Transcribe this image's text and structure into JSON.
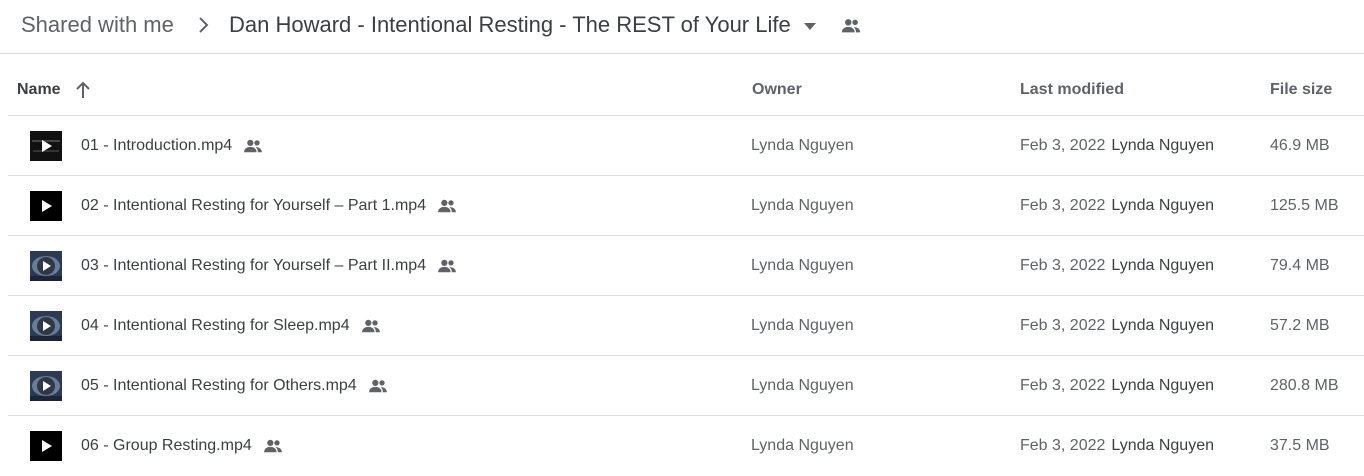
{
  "breadcrumb": {
    "root": "Shared with me",
    "current": "Dan Howard - Intentional Resting - The REST of Your Life",
    "separator_icon": "chevron-right-icon",
    "dropdown_icon": "caret-down-icon",
    "shared_icon": "people-icon"
  },
  "columns": {
    "name": "Name",
    "owner": "Owner",
    "last_modified": "Last modified",
    "file_size": "File size",
    "sort_icon": "arrow-up-icon"
  },
  "files": [
    {
      "name": "01 - Introduction.mp4",
      "owner": "Lynda Nguyen",
      "modified_date": "Feb 3, 2022",
      "modified_by": "Lynda Nguyen",
      "size": "46.9 MB",
      "thumb": "dark-frame"
    },
    {
      "name": "02 - Intentional Resting for Yourself – Part 1.mp4",
      "owner": "Lynda Nguyen",
      "modified_date": "Feb 3, 2022",
      "modified_by": "Lynda Nguyen",
      "size": "125.5 MB",
      "thumb": "black"
    },
    {
      "name": "03 - Intentional Resting for Yourself – Part II.mp4",
      "owner": "Lynda Nguyen",
      "modified_date": "Feb 3, 2022",
      "modified_by": "Lynda Nguyen",
      "size": "79.4 MB",
      "thumb": "blue-frame"
    },
    {
      "name": "04 - Intentional Resting for Sleep.mp4",
      "owner": "Lynda Nguyen",
      "modified_date": "Feb 3, 2022",
      "modified_by": "Lynda Nguyen",
      "size": "57.2 MB",
      "thumb": "blue-frame"
    },
    {
      "name": "05 - Intentional Resting for Others.mp4",
      "owner": "Lynda Nguyen",
      "modified_date": "Feb 3, 2022",
      "modified_by": "Lynda Nguyen",
      "size": "280.8 MB",
      "thumb": "blue-frame"
    },
    {
      "name": "06 - Group Resting.mp4",
      "owner": "Lynda Nguyen",
      "modified_date": "Feb 3, 2022",
      "modified_by": "Lynda Nguyen",
      "size": "37.5 MB",
      "thumb": "black"
    }
  ],
  "colors": {
    "text_primary": "#3c4043",
    "text_secondary": "#5f6368",
    "divider": "#dadce0"
  }
}
